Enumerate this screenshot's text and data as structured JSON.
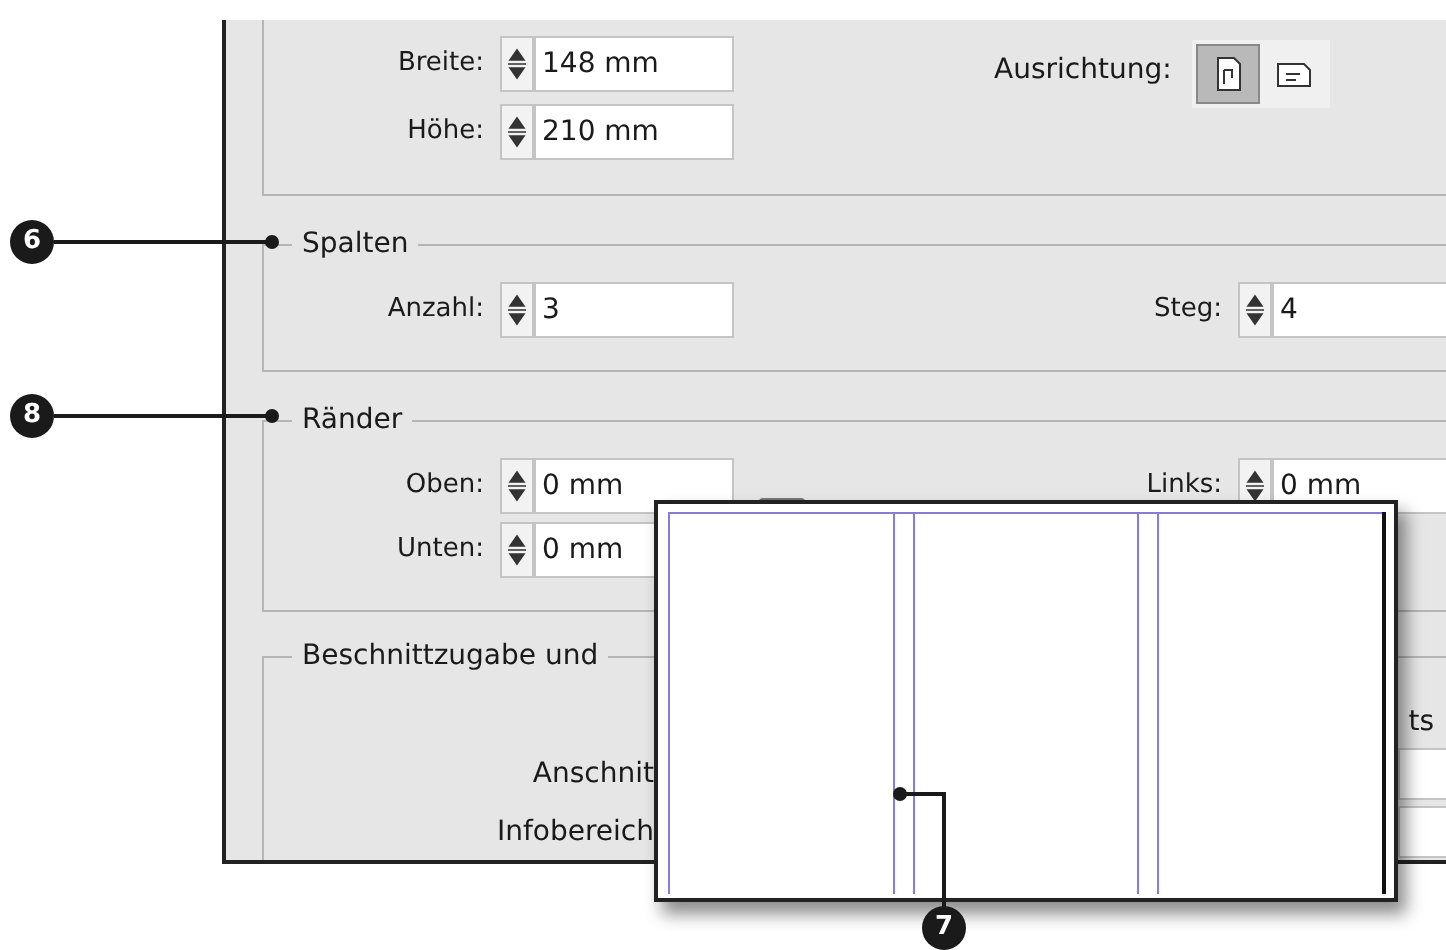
{
  "page_size": {
    "fields": [
      {
        "label": "Breite:",
        "value": "148 mm"
      },
      {
        "label": "Höhe:",
        "value": "210 mm"
      }
    ],
    "orientation": {
      "label": "Ausrichtung:",
      "options": [
        {
          "kind": "portrait",
          "selected": true
        },
        {
          "kind": "landscape",
          "selected": false
        }
      ]
    }
  },
  "columns": {
    "title": "Spalten",
    "count": {
      "label": "Anzahl:",
      "value": "3"
    },
    "gutter": {
      "label": "Steg:",
      "value": "4"
    }
  },
  "margins": {
    "title": "Ränder",
    "fields": [
      {
        "label": "Oben:",
        "value": "0 mm"
      },
      {
        "label": "Unten:",
        "value": "0 mm"
      }
    ],
    "side": {
      "label": "Links:",
      "value": "0 mm"
    }
  },
  "bleed": {
    "title": "Beschnittzugabe und",
    "column_header": "ts",
    "rows": [
      {
        "label": "Anschnit"
      },
      {
        "label": "Infobereich"
      }
    ]
  },
  "callouts": [
    {
      "number": "6"
    },
    {
      "number": "8"
    },
    {
      "number": "7"
    }
  ]
}
